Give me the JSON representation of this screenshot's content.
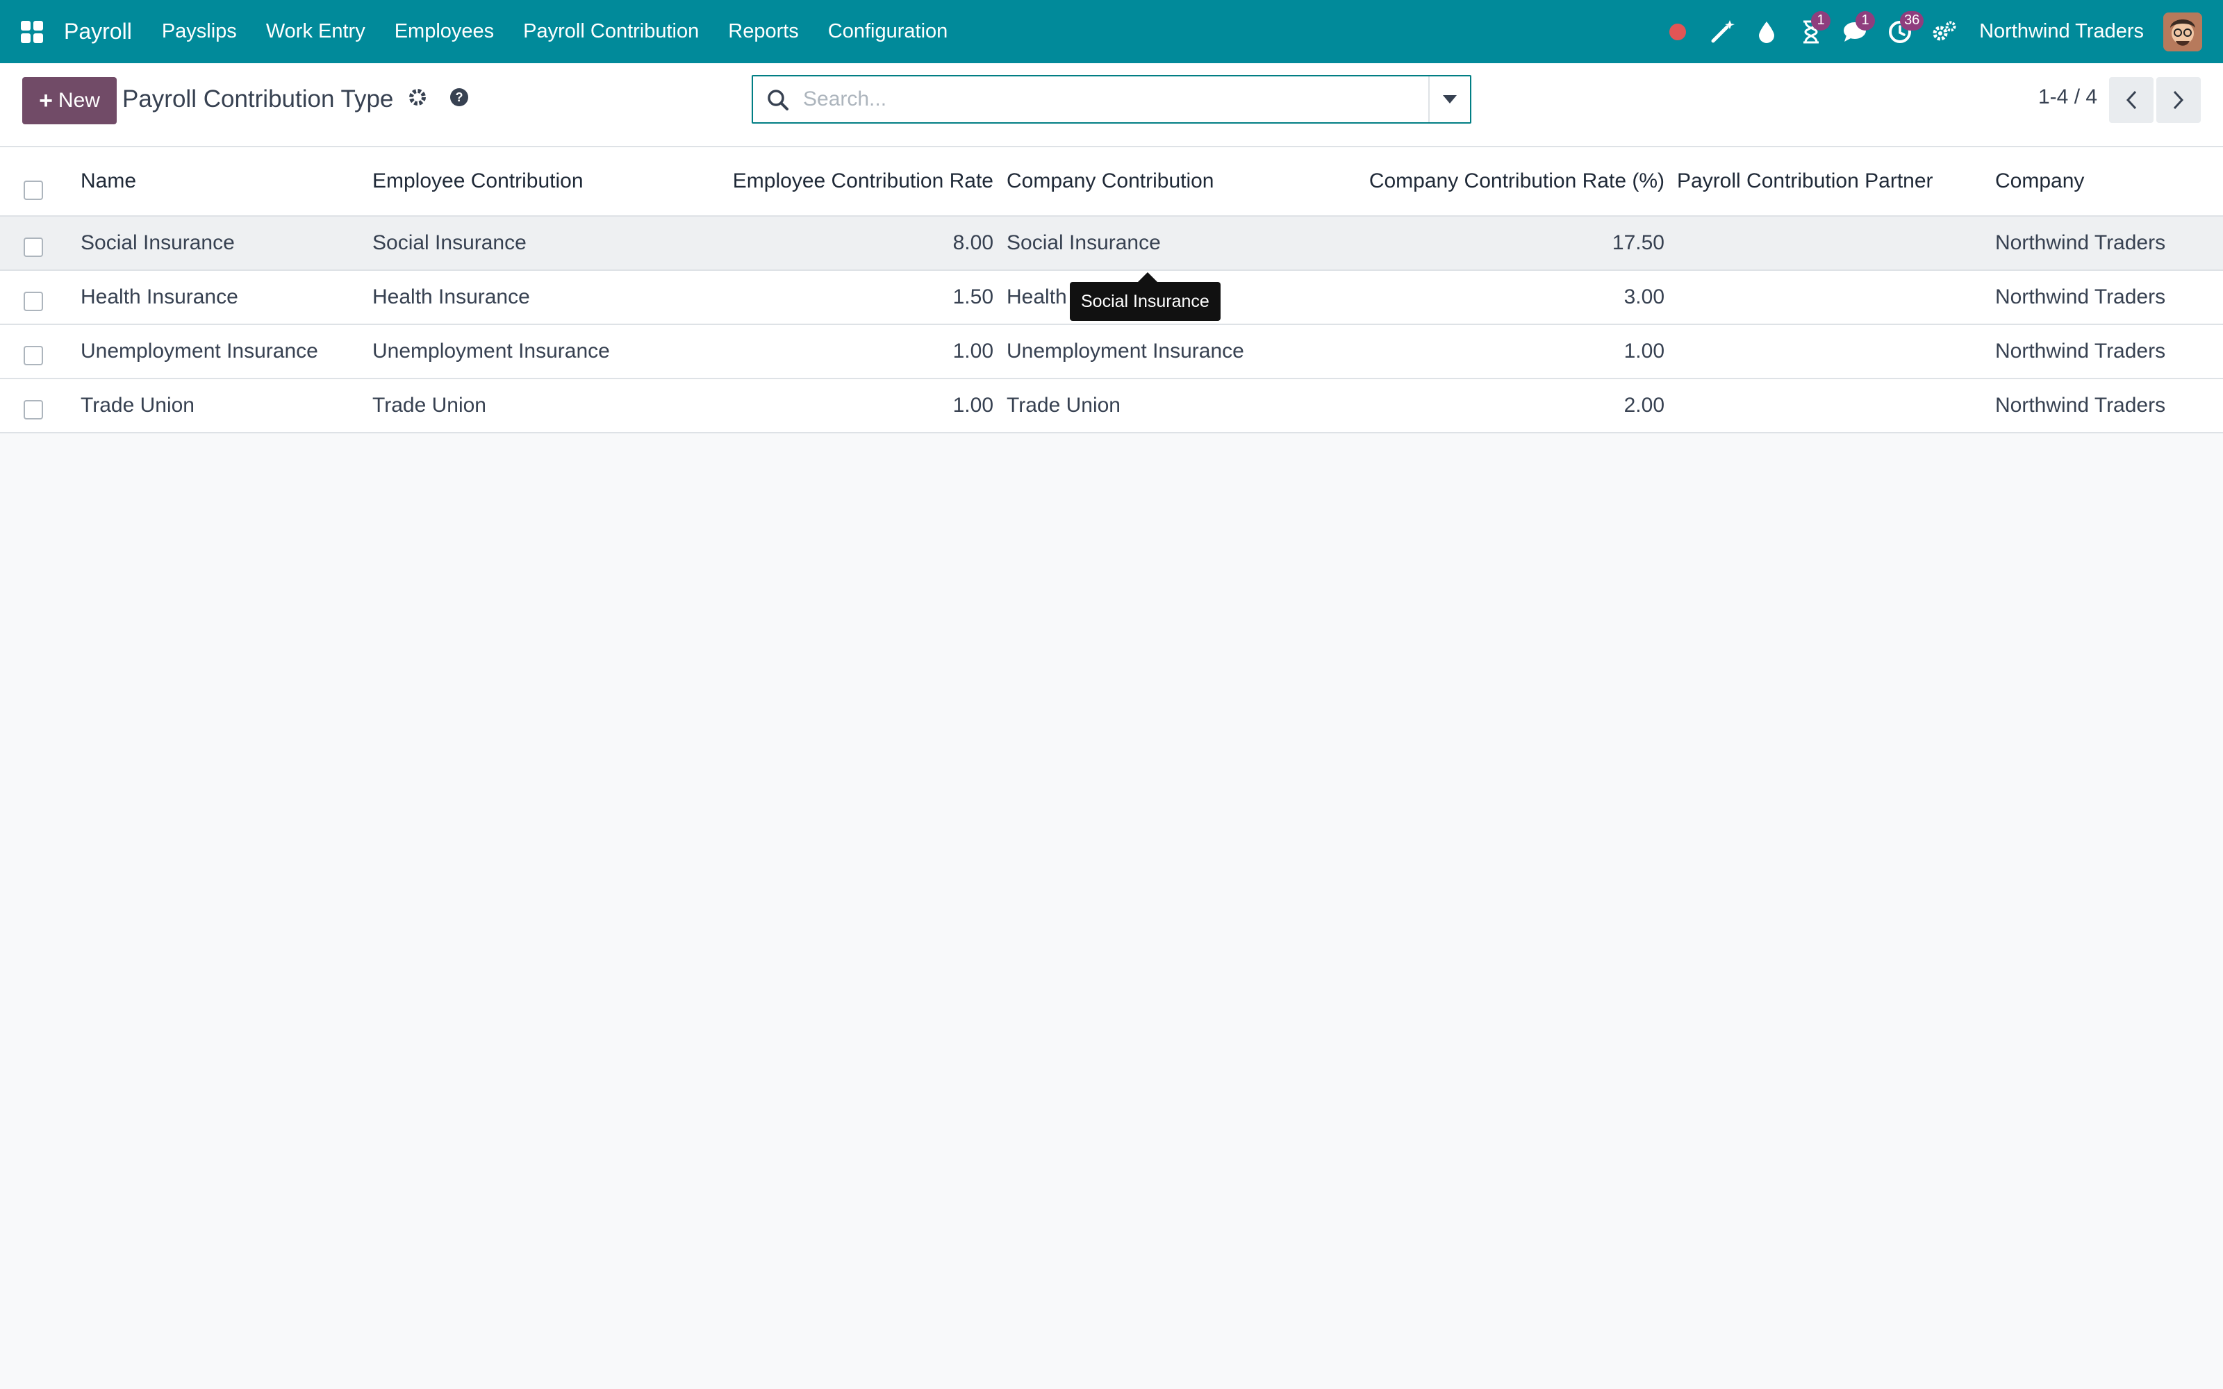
{
  "navbar": {
    "app_name": "Payroll",
    "menu": [
      "Payslips",
      "Work Entry",
      "Employees",
      "Payroll Contribution",
      "Reports",
      "Configuration"
    ],
    "badges": {
      "activities": "1",
      "messages": "1",
      "timer": "36"
    },
    "company": "Northwind Traders",
    "icons": [
      "apps-icon",
      "record-dot-icon",
      "magic-wand-icon",
      "drop-icon",
      "hourglass-icon",
      "chat-icon",
      "clock-icon",
      "settings-icon"
    ],
    "colors": {
      "bar": "#018a9a",
      "badge": "#8f3e7e",
      "record_dot": "#e25555"
    }
  },
  "control_panel": {
    "new_label": "New",
    "title": "Payroll Contribution Type",
    "search_placeholder": "Search...",
    "pager": "1-4 / 4",
    "accent": "#714b67"
  },
  "table": {
    "columns": [
      "Name",
      "Employee Contribution",
      "Employee Contribution Rate",
      "Company Contribution",
      "Company Contribution Rate (%)",
      "Payroll Contribution Partner",
      "Company"
    ],
    "rows": [
      {
        "name": "Social Insurance",
        "employee_contribution": "Social Insurance",
        "employee_rate": "8.00",
        "company_contribution": "Social Insurance",
        "company_rate": "17.50",
        "partner": "",
        "company": "Northwind Traders"
      },
      {
        "name": "Health Insurance",
        "employee_contribution": "Health Insurance",
        "employee_rate": "1.50",
        "company_contribution": "Health",
        "company_rate": "3.00",
        "partner": "",
        "company": "Northwind Traders"
      },
      {
        "name": "Unemployment Insurance",
        "employee_contribution": "Unemployment Insurance",
        "employee_rate": "1.00",
        "company_contribution": "Unemployment Insurance",
        "company_rate": "1.00",
        "partner": "",
        "company": "Northwind Traders"
      },
      {
        "name": "Trade Union",
        "employee_contribution": "Trade Union",
        "employee_rate": "1.00",
        "company_contribution": "Trade Union",
        "company_rate": "2.00",
        "partner": "",
        "company": "Northwind Traders"
      }
    ]
  },
  "tooltip": {
    "text": "Social Insurance"
  }
}
